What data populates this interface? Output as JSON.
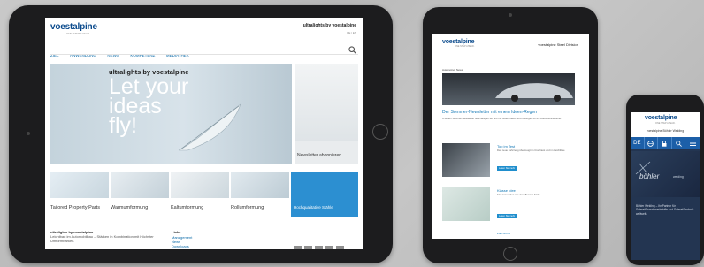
{
  "tablet_large": {
    "logo": "voestalpine",
    "tagline": "ONE STEP AHEAD.",
    "header_title": "ultralights by voestalpine",
    "header_meta": "DE | EN",
    "nav": [
      "ZIEL",
      "ANWENDUNG",
      "NEWS",
      "KOMPETENZ",
      "MEDIATHEK"
    ],
    "hero_brand": "ultralights by voestalpine",
    "hero_headline": [
      "Let your",
      "ideas",
      "fly!"
    ],
    "newsletter_label": "Newsletter abonnieren",
    "tiles": [
      "Tailored Property Parts",
      "Warmumformung",
      "Kaltumformung",
      "Rollumformung",
      "Hochqualitative Stähle"
    ],
    "footer_title": "ultralights by voestalpine",
    "footer_text": "Leichtbau im Automobilbau – Stärken in Kombination mit höchster Umformbarkeit.",
    "links_title": "Links",
    "links": [
      "Management",
      "News",
      "Downloads"
    ]
  },
  "tablet_small": {
    "logo": "voestalpine",
    "tagline": "ONE STEP AHEAD.",
    "header_title": "voestalpine Steel Division",
    "section_label": "Automotive News",
    "headline": "Der Sommer-Newsletter mit einem Ideen-Regen",
    "body": "In einem Sommer-Newsletter beschäftigen wir uns mit neuen Ideen und Lösungen für die Automobilindustrie.",
    "story1_title": "Top im Test",
    "story1_text": "Das neue Fahrzeug überzeugt im Crashtest und im Leichtbau.",
    "story1_button": "Lesen Sie mehr",
    "story2_title": "Klasse Idee",
    "story2_text": "Eine Innovation aus dem Bereich Stahl.",
    "story2_button": "Lesen Sie mehr",
    "more_link": "Zum Archiv"
  },
  "phone": {
    "logo": "voestalpine",
    "tagline": "ONE STEP AHEAD.",
    "header_title": "voestalpine Böhler Welding",
    "lang": "DE",
    "brand": "böhler",
    "brand_sub": "welding",
    "text": "Böhler Welding – Ihr Partner für Schweißzusatzwerkstoffe und Schweißtechnik weltweit."
  }
}
